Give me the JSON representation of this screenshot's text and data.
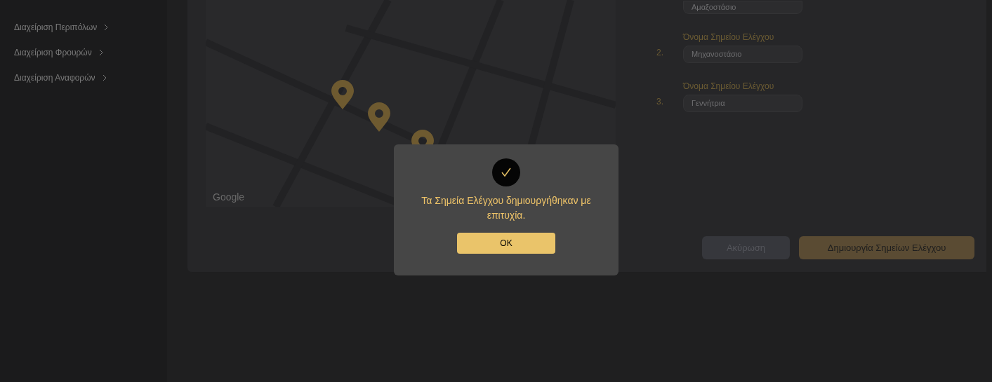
{
  "sidebar": {
    "items": [
      {
        "label": "Διαχείριση Περιπόλων",
        "expanded": false
      },
      {
        "label": "Διαχείριση Φρουρών",
        "expanded": false
      },
      {
        "label": "Διαχείριση Αναφορών",
        "expanded": false
      }
    ]
  },
  "map": {
    "attribution": "Google"
  },
  "checkpoints": [
    {
      "value": "Αμαξοστάσιο"
    },
    {
      "number": "2.",
      "label": "Όνομα Σημείου Ελέγχου",
      "value": "Μηχανοστάσιο"
    },
    {
      "number": "3.",
      "label": "Όνομα Σημείου Ελέγχου",
      "value": "Γεννήτρια"
    }
  ],
  "buttons": [
    {
      "kind": "secondary",
      "label": "Ακύρωση"
    },
    {
      "kind": "primary",
      "label": "Δημιουργία Σημείων Ελέγχου"
    }
  ],
  "dialog": {
    "message": "Τα Σημεία Ελέγχου δημιουργήθηκαν με επιτυχία.",
    "button": "OK"
  }
}
